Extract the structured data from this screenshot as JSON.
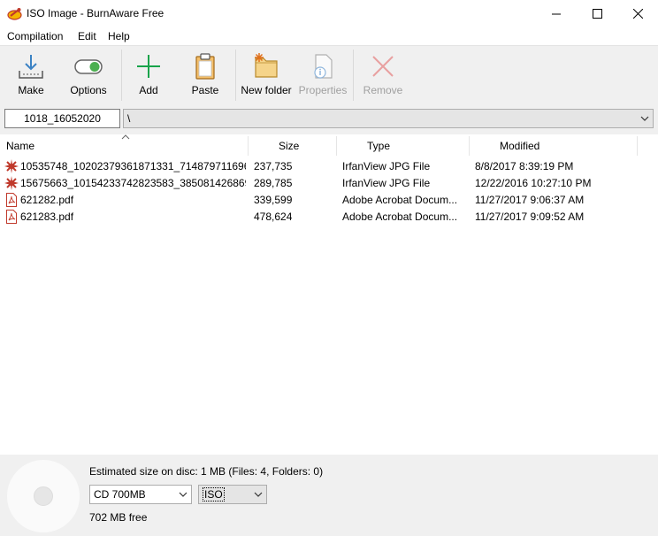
{
  "window": {
    "title": "ISO Image - BurnAware Free"
  },
  "menu": [
    "Compilation",
    "Edit",
    "Help"
  ],
  "toolbar": {
    "make": "Make",
    "options": "Options",
    "add": "Add",
    "paste": "Paste",
    "new_folder": "New folder",
    "properties": "Properties",
    "remove": "Remove"
  },
  "address": {
    "label": "1018_16052020",
    "path": "\\"
  },
  "columns": {
    "name": "Name",
    "size": "Size",
    "type": "Type",
    "modified": "Modified"
  },
  "files": [
    {
      "icon": "jpg-file-icon",
      "name": "10535748_10202379361871331_71487971169663...",
      "size": "237,735",
      "type": "IrfanView JPG File",
      "modified": "8/8/2017 8:39:19 PM"
    },
    {
      "icon": "jpg-file-icon",
      "name": "15675663_10154233742823583_38508142686949...",
      "size": "289,785",
      "type": "IrfanView JPG File",
      "modified": "12/22/2016 10:27:10 PM"
    },
    {
      "icon": "pdf-file-icon",
      "name": "621282.pdf",
      "size": "339,599",
      "type": "Adobe Acrobat Docum...",
      "modified": "11/27/2017 9:06:37 AM"
    },
    {
      "icon": "pdf-file-icon",
      "name": "621283.pdf",
      "size": "478,624",
      "type": "Adobe Acrobat Docum...",
      "modified": "11/27/2017 9:09:52 AM"
    }
  ],
  "status": {
    "estimate": "Estimated size on disc: 1 MB (Files: 4, Folders: 0)",
    "disc_type": "CD 700MB",
    "format": "ISO",
    "free": "702 MB free"
  },
  "colors": {
    "accent_green": "#16a34a",
    "remove_red": "#e06666",
    "toolbar_bg": "#f0f0f0"
  }
}
